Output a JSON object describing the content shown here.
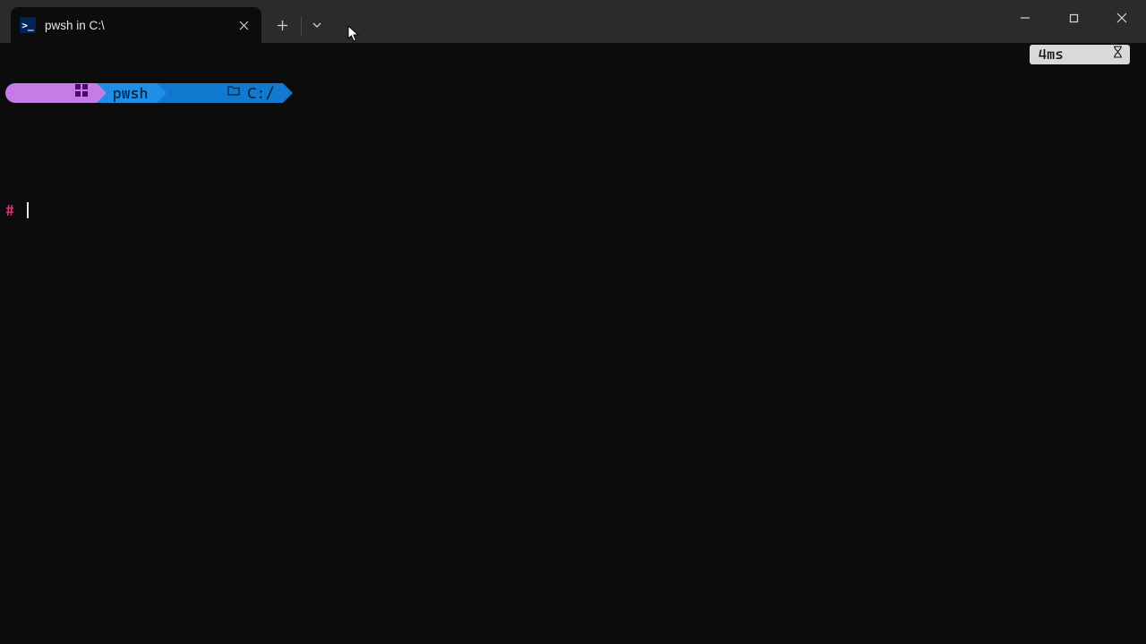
{
  "tab": {
    "title": "pwsh in C:\\",
    "icon_label": ">_"
  },
  "prompt": {
    "shell": "pwsh",
    "path": "C:/",
    "prefix": "#"
  },
  "rprompt": {
    "timing": "4ms"
  },
  "colors": {
    "accent_purple": "#c57ce6",
    "accent_blue1": "#1f8fe6",
    "accent_blue2": "#1279d1",
    "hash": "#e2317e"
  }
}
